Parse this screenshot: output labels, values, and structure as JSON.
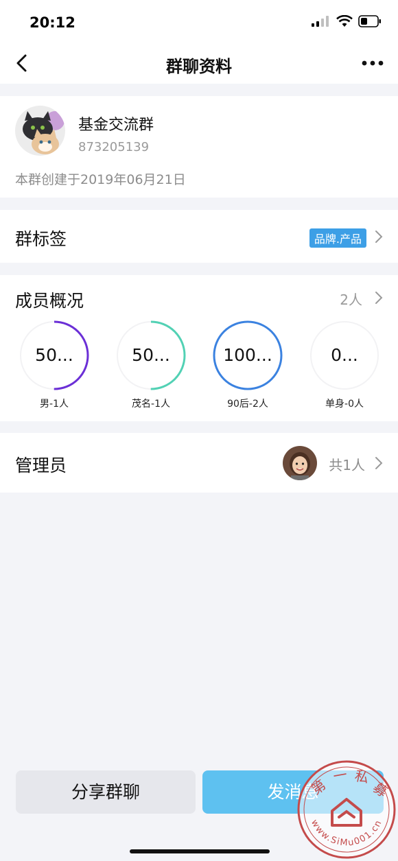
{
  "status_bar": {
    "time": "20:12"
  },
  "nav": {
    "title": "群聊资料",
    "back_icon": "chevron-left-icon",
    "more_icon": "more-dots-icon"
  },
  "group": {
    "name": "基金交流群",
    "id": "873205139",
    "created": "本群创建于2019年06月21日"
  },
  "tag_row": {
    "title": "群标签",
    "tag": "品牌.产品"
  },
  "members": {
    "title": "成员概况",
    "count": "2人",
    "stats": [
      {
        "value": "50...",
        "label": "男-1人",
        "percent": 50,
        "color": "#6b2fd6"
      },
      {
        "value": "50...",
        "label": "茂名-1人",
        "percent": 50,
        "color": "#52d1b4"
      },
      {
        "value": "100...",
        "label": "90后-2人",
        "percent": 100,
        "color": "#3b82e0"
      },
      {
        "value": "0...",
        "label": "单身-0人",
        "percent": 0,
        "color": "#3b82e0"
      }
    ]
  },
  "admin_row": {
    "title": "管理员",
    "count": "共1人"
  },
  "actions": {
    "share": "分享群聊",
    "send": "发消息"
  },
  "watermark": {
    "text_chars": [
      "第",
      "一",
      "私",
      "募"
    ],
    "url": "www.SiMu001.cn"
  }
}
